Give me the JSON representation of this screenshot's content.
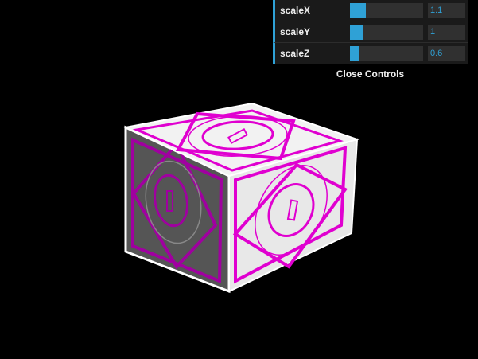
{
  "controls": {
    "sliders": [
      {
        "label": "scaleX",
        "value": "1.1",
        "fill": 0.22
      },
      {
        "label": "scaleY",
        "value": "1",
        "fill": 0.19
      },
      {
        "label": "scaleZ",
        "value": "0.6",
        "fill": 0.12
      }
    ],
    "close_label": "Close Controls"
  },
  "scene": {
    "background": "#000000",
    "accent": "#2fa1d6",
    "pattern_color": "#e000d0",
    "pattern_color_shaded": "#a000a0",
    "face_light": "#eeeeee",
    "face_mid": "#d8d8d8",
    "face_shaded": "#555555"
  }
}
